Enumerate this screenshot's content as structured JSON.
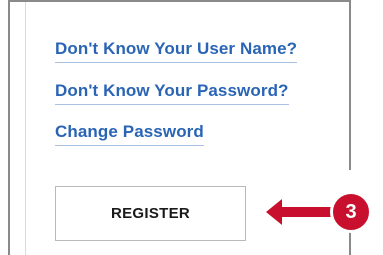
{
  "links": {
    "forgot_username": "Don't Know Your User Name?",
    "forgot_password": "Don't Know Your Password?",
    "change_password": "Change Password"
  },
  "register": {
    "label": "REGISTER"
  },
  "annotation": {
    "step_number": "3",
    "color": "#c8102e",
    "arrow_icon": "left-arrow-icon"
  },
  "colors": {
    "link": "#2a65b5",
    "button_border": "#b9b9b9",
    "panel_border": "#8a8a8a"
  }
}
